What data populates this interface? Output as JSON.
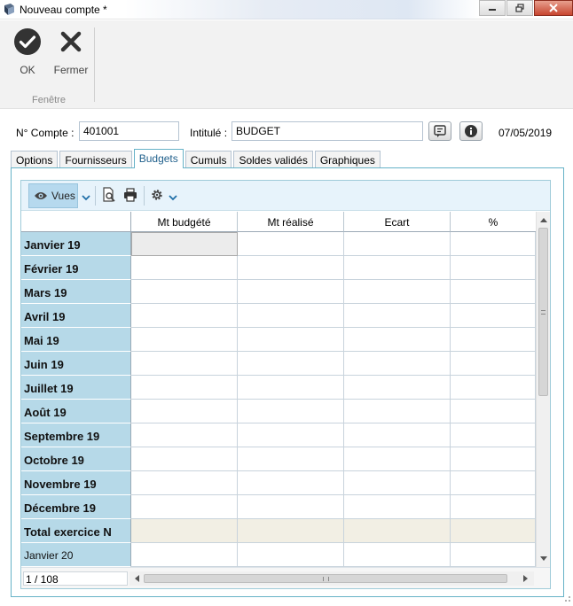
{
  "window": {
    "title": "Nouveau compte *"
  },
  "ribbon": {
    "ok_label": "OK",
    "close_label": "Fermer",
    "group_label": "Fenêtre"
  },
  "form": {
    "account_label": "N° Compte :",
    "account_value": "401001",
    "title_label": "Intitulé :",
    "title_value": "BUDGET",
    "date": "07/05/2019"
  },
  "tabs": [
    {
      "label": "Options",
      "active": false
    },
    {
      "label": "Fournisseurs",
      "active": false
    },
    {
      "label": "Budgets",
      "active": true
    },
    {
      "label": "Cumuls",
      "active": false
    },
    {
      "label": "Soldes validés",
      "active": false
    },
    {
      "label": "Graphiques",
      "active": false
    }
  ],
  "grid_toolbar": {
    "views_label": "Vues"
  },
  "grid": {
    "columns": [
      "Mt budgété",
      "Mt réalisé",
      "Ecart",
      "%"
    ],
    "rows": [
      {
        "label": "Janvier 19",
        "bold": true
      },
      {
        "label": "Février 19",
        "bold": true
      },
      {
        "label": "Mars 19",
        "bold": true
      },
      {
        "label": "Avril 19",
        "bold": true
      },
      {
        "label": "Mai 19",
        "bold": true
      },
      {
        "label": "Juin 19",
        "bold": true
      },
      {
        "label": "Juillet 19",
        "bold": true
      },
      {
        "label": "Août 19",
        "bold": true
      },
      {
        "label": "Septembre 19",
        "bold": true
      },
      {
        "label": "Octobre 19",
        "bold": true
      },
      {
        "label": "Novembre 19",
        "bold": true
      },
      {
        "label": "Décembre 19",
        "bold": true
      },
      {
        "label": "Total exercice N",
        "bold": true,
        "total": true
      },
      {
        "label": "Janvier 20",
        "bold": false
      },
      {
        "label": "",
        "bold": false
      }
    ]
  },
  "pager": {
    "text": "1 / 108"
  },
  "colors": {
    "accent_border": "#66b2c7",
    "row_header_bg": "#b6d9e8",
    "toolbar_bg": "#e7f3fb",
    "total_row_bg": "#f2efe4"
  }
}
